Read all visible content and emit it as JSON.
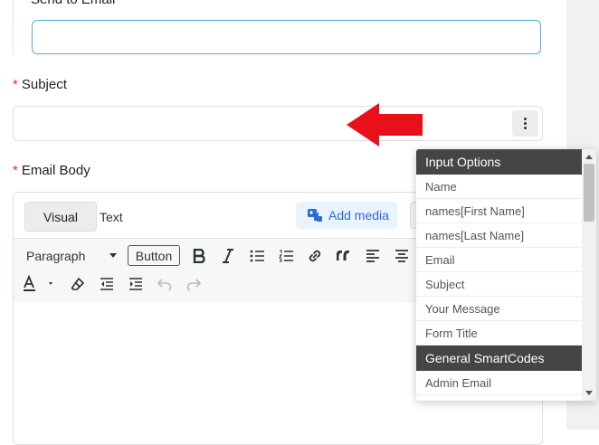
{
  "form": {
    "send_to_label": "Send to Email",
    "subject_label": "Subject",
    "email_body_label": "Email Body",
    "required_mark": "*"
  },
  "editor": {
    "tab_visual": "Visual",
    "tab_text": "Text",
    "add_media": "Add media",
    "format_select": "Paragraph",
    "button_label": "Button"
  },
  "dropdown": {
    "groups": [
      {
        "title": "Input Options",
        "items": [
          "Name",
          "names[First Name]",
          "names[Last Name]",
          "Email",
          "Subject",
          "Your Message",
          "Form Title"
        ]
      },
      {
        "title": "General SmartCodes",
        "items": [
          "Admin Email"
        ]
      }
    ]
  },
  "colors": {
    "accent": "#2c6bd6",
    "required": "#e02b2b",
    "annotation_arrow": "#e8101a",
    "dropdown_header": "#454545"
  }
}
